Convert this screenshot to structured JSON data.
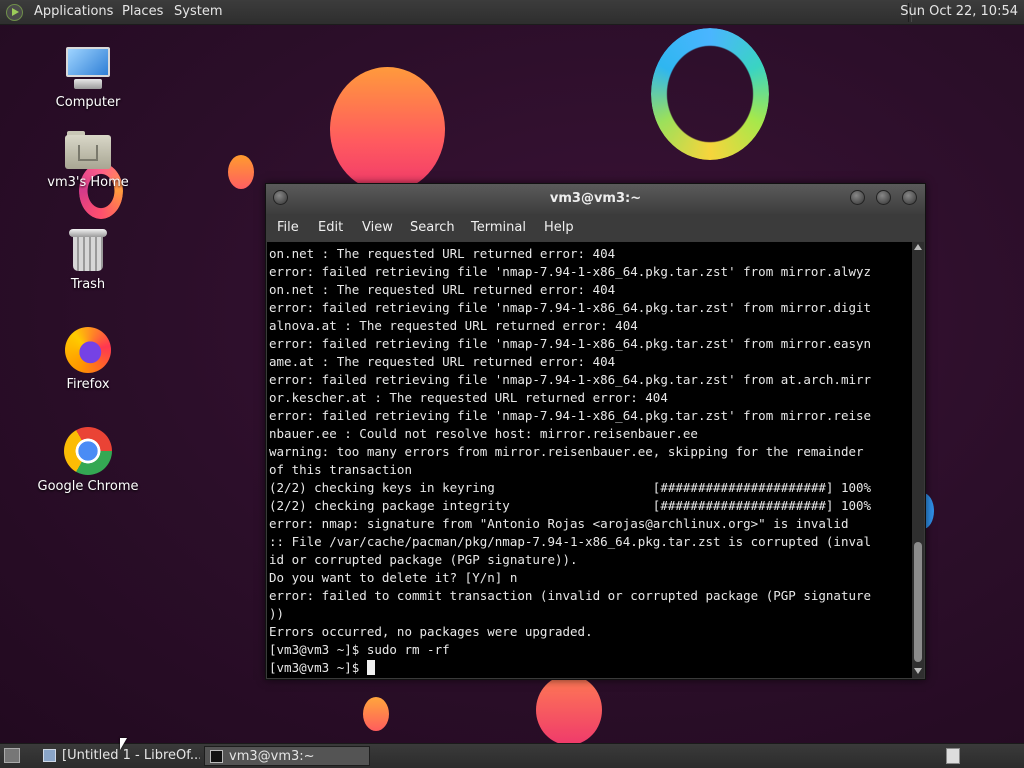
{
  "top_panel": {
    "menus": [
      "Applications",
      "Places",
      "System"
    ],
    "clock": "Sun Oct 22, 10:54"
  },
  "desktop_icons": [
    {
      "label": "Computer",
      "icon": "computer-icon"
    },
    {
      "label": "vm3's Home",
      "icon": "home-folder-icon"
    },
    {
      "label": "Trash",
      "icon": "trash-icon"
    },
    {
      "label": "Firefox",
      "icon": "firefox-icon"
    },
    {
      "label": "Google Chrome",
      "icon": "chrome-icon"
    }
  ],
  "terminal": {
    "title": "vm3@vm3:~",
    "menu": [
      "File",
      "Edit",
      "View",
      "Search",
      "Terminal",
      "Help"
    ],
    "lines": [
      "on.net : The requested URL returned error: 404",
      "error: failed retrieving file 'nmap-7.94-1-x86_64.pkg.tar.zst' from mirror.alwyz",
      "on.net : The requested URL returned error: 404",
      "error: failed retrieving file 'nmap-7.94-1-x86_64.pkg.tar.zst' from mirror.digit",
      "alnova.at : The requested URL returned error: 404",
      "error: failed retrieving file 'nmap-7.94-1-x86_64.pkg.tar.zst' from mirror.easyn",
      "ame.at : The requested URL returned error: 404",
      "error: failed retrieving file 'nmap-7.94-1-x86_64.pkg.tar.zst' from at.arch.mirr",
      "or.kescher.at : The requested URL returned error: 404",
      "error: failed retrieving file 'nmap-7.94-1-x86_64.pkg.tar.zst' from mirror.reise",
      "nbauer.ee : Could not resolve host: mirror.reisenbauer.ee",
      "warning: too many errors from mirror.reisenbauer.ee, skipping for the remainder",
      "of this transaction",
      "(2/2) checking keys in keyring                     [######################] 100%",
      "(2/2) checking package integrity                   [######################] 100%",
      "error: nmap: signature from \"Antonio Rojas <arojas@archlinux.org>\" is invalid",
      ":: File /var/cache/pacman/pkg/nmap-7.94-1-x86_64.pkg.tar.zst is corrupted (inval",
      "id or corrupted package (PGP signature)).",
      "Do you want to delete it? [Y/n] n",
      "error: failed to commit transaction (invalid or corrupted package (PGP signature",
      "))",
      "Errors occurred, no packages were upgraded.",
      "[vm3@vm3 ~]$ sudo rm -rf",
      "[vm3@vm3 ~]$ "
    ]
  },
  "taskbar": {
    "tasks": [
      {
        "label": "[Untitled 1 - LibreOf...",
        "icon": "document-icon",
        "active": false
      },
      {
        "label": "vm3@vm3:~",
        "icon": "terminal-icon",
        "active": true
      }
    ]
  }
}
